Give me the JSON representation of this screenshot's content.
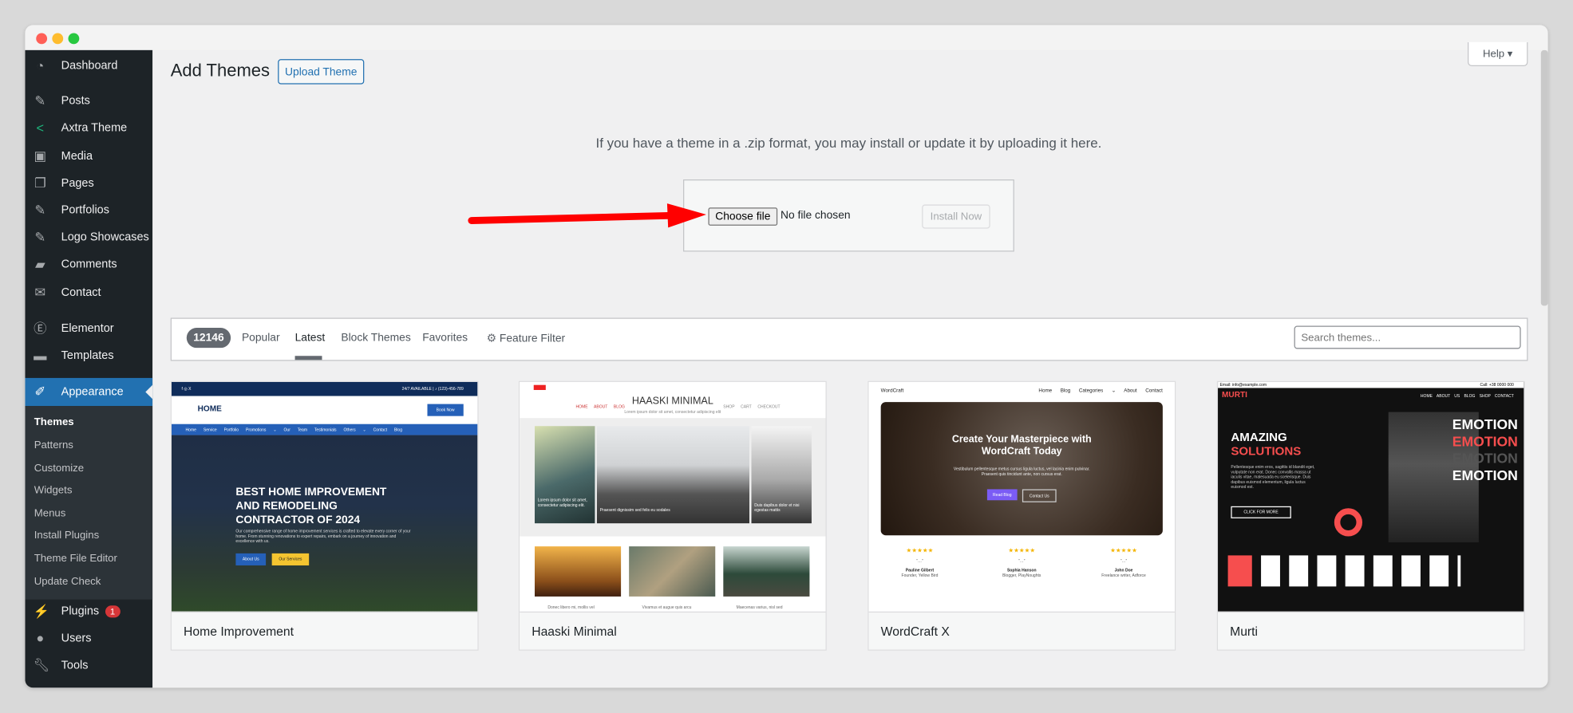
{
  "window": {
    "traffic_lights": [
      "#ff5f57",
      "#febc2e",
      "#28c840"
    ]
  },
  "sidebar": {
    "items": [
      {
        "label": "Dashboard",
        "icon": "dashboard-icon"
      },
      {
        "label": "Posts",
        "icon": "pin-icon"
      },
      {
        "label": "Axtra Theme",
        "icon": "axtra-icon"
      },
      {
        "label": "Media",
        "icon": "media-icon"
      },
      {
        "label": "Pages",
        "icon": "pages-icon"
      },
      {
        "label": "Portfolios",
        "icon": "pin-icon"
      },
      {
        "label": "Logo Showcases",
        "icon": "pin-icon"
      },
      {
        "label": "Comments",
        "icon": "comment-icon"
      },
      {
        "label": "Contact",
        "icon": "mail-icon"
      },
      {
        "label": "Elementor",
        "icon": "elementor-icon"
      },
      {
        "label": "Templates",
        "icon": "folder-icon"
      },
      {
        "label": "Appearance",
        "icon": "brush-icon",
        "active": true
      },
      {
        "label": "Plugins",
        "icon": "plugin-icon",
        "badge": "1"
      },
      {
        "label": "Users",
        "icon": "user-icon"
      },
      {
        "label": "Tools",
        "icon": "wrench-icon"
      }
    ],
    "submenu": [
      "Themes",
      "Patterns",
      "Customize",
      "Widgets",
      "Menus",
      "Install Plugins",
      "Theme File Editor",
      "Update Check"
    ],
    "accent": "#2271b1"
  },
  "header": {
    "title": "Add Themes",
    "upload_button": "Upload Theme",
    "help": "Help ▾"
  },
  "upload": {
    "instructions": "If you have a theme in a .zip format, you may install or update it by uploading it here.",
    "choose_file": "Choose file",
    "no_file": "No file chosen",
    "install_now": "Install Now",
    "arrow_color": "#ff0000"
  },
  "filter": {
    "count": "12146",
    "tabs": [
      "Popular",
      "Latest",
      "Block Themes",
      "Favorites"
    ],
    "active_tab": "Latest",
    "feature_filter": "Feature Filter",
    "search_placeholder": "Search themes..."
  },
  "themes": [
    {
      "name": "Home Improvement",
      "preview": {
        "topbar": "24/7 AVAILABLE  |  ♪ (123)-456-789",
        "logo": "HOME",
        "book": "Book Now",
        "nav": [
          "Home",
          "Service",
          "Portfolio",
          "Promotions ⌄",
          "Our Team",
          "Testimonials",
          "Others ⌄",
          "Contact",
          "Blog"
        ],
        "headline": "BEST HOME IMPROVEMENT AND REMODELING CONTRACTOR OF 2024",
        "body": "Our comprehensive range of home improvement services is crafted to elevate every corner of your home. From stunning renovations to expert repairs, embark on a journey of innovation and excellence with us.",
        "btn1": "About Us",
        "btn2": "Our Services"
      }
    },
    {
      "name": "Haaski Minimal",
      "preview": {
        "title": "HAASKI MINIMAL",
        "tagline": "Lorem ipsum dolor sit amet, consectetur adipiscing elit",
        "nav_left": [
          "HOME",
          "ABOUT",
          "BLOG"
        ],
        "nav_right": [
          "SHOP",
          "CART",
          "CHECKOUT"
        ],
        "slide1": "Lorem ipsum dolor sit amet, consectetur adipiscing elit.",
        "slide2": "Praesent dignissim sed felis eu sodales",
        "slide3": "Duis dapibus dolor et nisi egestas mattis",
        "captions": [
          "Donec libero mi, mollis vel",
          "Vivamus et augue quis arcu",
          "Maecenas varius, nisl sed"
        ]
      }
    },
    {
      "name": "WordCraft X",
      "preview": {
        "logo": "WordCraft",
        "nav": [
          "Home",
          "Blog",
          "Categories ⌄",
          "About",
          "Contact"
        ],
        "headline": "Create Your Masterpiece with WordCraft Today",
        "body": "Vestibulum pellentesque metus cursus ligula luctus, vel lacinia enim pulvinar. Praesent quis tincidunt ante, non cursus erat.",
        "btn1": "Read Blog",
        "btn2": "Contact Us",
        "stars": "★★★★★",
        "people": [
          {
            "name": "Pauline Gilbert",
            "role": "Founder, Yellow Bird"
          },
          {
            "name": "Sophia Hanson",
            "role": "Blogger, PlayNoughts"
          },
          {
            "name": "John Doe",
            "role": "Freelance writer, Adforce"
          }
        ]
      }
    },
    {
      "name": "Murti",
      "preview": {
        "email": "Email: info@example.com",
        "phone": "Call: +38 0000 000",
        "logo": "MURTI",
        "nav": [
          "HOME",
          "ABOUT US",
          "BLOG",
          "SHOP",
          "CONTACT"
        ],
        "headline1": "AMAZING",
        "headline2": "SOLUTIONS",
        "body": "Pellentesque enim eros, sagittis id blandit eget, vulputate non erat. Donec convallis massa ut iaculis vitae, malesuada eu scelerisque. Duis dapibus euismod elementum, ligula luctus euismod est.",
        "cta": "CLICK FOR MORE",
        "emotion": "EMOTION",
        "accent": "#f64e4e"
      }
    }
  ]
}
